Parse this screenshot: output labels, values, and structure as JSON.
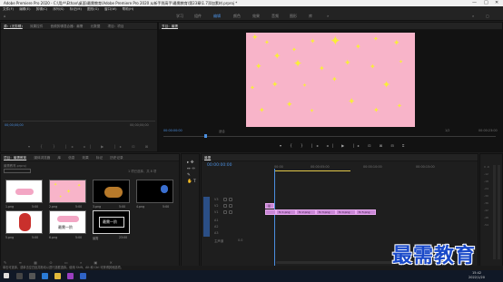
{
  "window": {
    "title": "Adobe Premiere Pro 2020 - C:\\用户\\Ethan\\桌面\\最需教育\\Adobe Premiere Pro 2020 从新手到高手\\最需教育\\第23章\\1.7添加素材.prproj *",
    "controls": [
      "—",
      "□",
      "✕"
    ]
  },
  "menu": [
    "文件(F)",
    "编辑(E)",
    "剪辑(C)",
    "序列(S)",
    "标记(M)",
    "图形(G)",
    "窗口(W)",
    "帮助(H)"
  ],
  "workspaces": {
    "items": [
      "学习",
      "组件",
      "编辑",
      "颜色",
      "效果",
      "音频",
      "图形",
      "库"
    ],
    "active_index": 2
  },
  "source_panel": {
    "tabs": [
      "源：(无剪辑)",
      "效果控件",
      "音频剪辑混合器：最需",
      "元数据",
      "项目：项目"
    ],
    "timecode": "00;00;00;00",
    "timecode_right": "00;00;00;00"
  },
  "program_panel": {
    "tab": "节目：最需",
    "timecode": "00:00:00:00",
    "fit": "适合",
    "quality": "1/2",
    "duration": "00:00:23:00"
  },
  "project_panel": {
    "tabs": [
      "项目：最需教育",
      "媒体浏览器",
      "库",
      "信息",
      "效果",
      "标记",
      "历史记录"
    ],
    "project_name": "最需教育.prproj",
    "item_count": "1 项已选择，共 8 项",
    "items": [
      {
        "name": "1.png",
        "duration": "5:00"
      },
      {
        "name": "2.png",
        "duration": "5:00"
      },
      {
        "name": "3.png",
        "duration": "5:00"
      },
      {
        "name": "4.png",
        "duration": "5:00"
      },
      {
        "name": "5.png",
        "duration": "5:00"
      },
      {
        "name": "6.png",
        "duration": "5:00"
      },
      {
        "name": "7.png",
        "duration": "5:00"
      },
      {
        "name": "最需",
        "duration": "23:00"
      }
    ],
    "thumb_text": "最需一阶",
    "clip_text": "最需一阶"
  },
  "timeline": {
    "tab": "最需",
    "timecode": "00:00:00:00",
    "ruler": [
      "00:00",
      "00:00:05:00",
      "00:00:10:00",
      "00:00:15:00"
    ],
    "video_tracks": [
      "V3",
      "V2",
      "V1"
    ],
    "audio_tracks": [
      "A1",
      "A2",
      "A3"
    ],
    "master": "主声道",
    "master_value": "0.0",
    "clips_v2": "最",
    "clips_v1": [
      "fx 1.png",
      "fx 2.png",
      "fx 3.png",
      "fx 4.png",
      "fx 5.png"
    ]
  },
  "status_bar": "单击可选择，或单击空白处并拖动以进行选框选择。使用 Shift、Alt 和 Ctrl 可获得其他选项。",
  "taskbar": {
    "time": "15:42",
    "date": "2022/1/20"
  },
  "watermark": "最需教育"
}
